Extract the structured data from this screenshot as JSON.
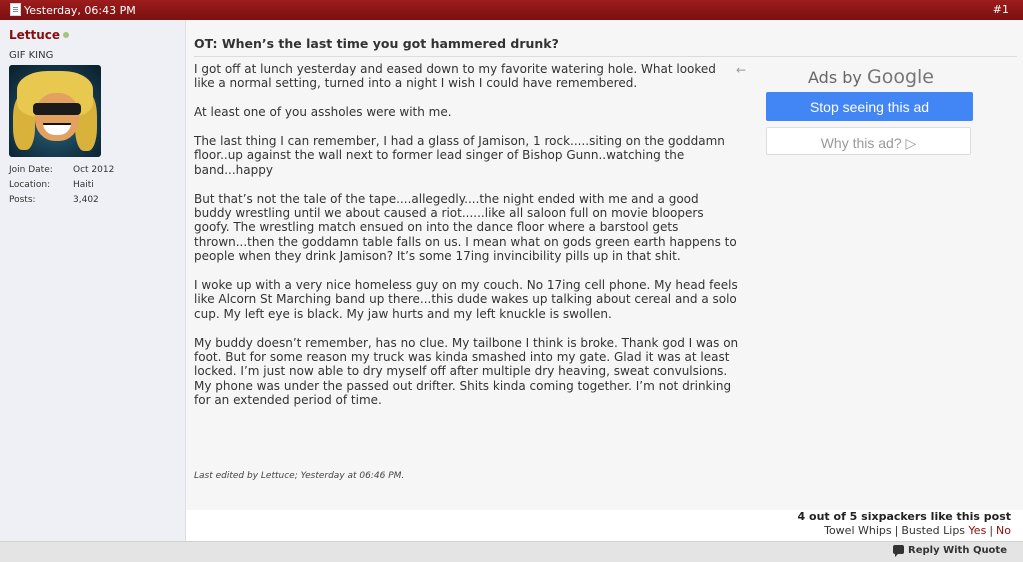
{
  "post": {
    "date": "Yesterday, 06:43 PM",
    "number": "#1"
  },
  "user": {
    "name": "Lettuce",
    "title": "GIF KING",
    "stats": [
      {
        "label": "Join Date:",
        "value": "Oct 2012"
      },
      {
        "label": "Location:",
        "value": "Haiti"
      },
      {
        "label": "Posts:",
        "value": "3,402"
      }
    ]
  },
  "message": {
    "title": "OT: When’s the last time you got hammered drunk?",
    "paragraphs": [
      "I got off at lunch yesterday and eased down to my favorite watering hole. What looked like a normal setting, turned into a night I wish I could have remembered.",
      "At least one of you assholes were with me.",
      "The last thing I can remember, I had a glass of Jamison, 1 rock.....siting on the goddamn floor..up against the wall next to former lead singer of Bishop Gunn..watching the band...happy",
      "But that’s not the tale of the tape....allegedly....the night ended with me and a good buddy wrestling until we about caused a riot......like all saloon full on movie bloopers goofy. The wrestling match ensued on into the dance floor where a barstool gets thrown...then the goddamn table falls on us. I mean what on gods green earth happens to people when they drink Jamison? It’s some 17ing invincibility pills up in that shit.",
      "I woke up with a very nice homeless guy on my couch. No 17ing cell phone. My head feels like Alcorn St Marching band up there...this dude wakes up talking about cereal and a solo cup. My left eye is black. My jaw hurts and my left knuckle is swollen.",
      "My buddy doesn’t remember, has no clue. My tailbone I think is broke. Thank god I was on foot. But for some reason my truck was kinda smashed into my gate. Glad it was at least locked. I’m just now able to dry myself off after multiple dry heaving, sweat convulsions. My phone was under the passed out drifter. Shits kinda coming together. I’m not drinking for an extended period of time."
    ],
    "edited": "Last edited by Lettuce; Yesterday at 06:46 PM."
  },
  "ad": {
    "back_arrow": "←",
    "ads_by": "Ads by",
    "google": "Google",
    "stop_label": "Stop seeing this ad",
    "why_label": "Why this ad? ▷"
  },
  "likes": {
    "summary": "4 out of 5 sixpackers like this post",
    "option1": "Towel Whips",
    "option2": "Busted Lips",
    "yes": "Yes",
    "no": "No"
  },
  "footer": {
    "reply_label": "Reply With Quote"
  },
  "colors": {
    "header_bar": "#8b1515",
    "username": "#8b0c0c",
    "ad_button": "#4285f4"
  },
  "icons": [
    "document-icon",
    "online-status-icon",
    "back-arrow-icon",
    "reply-quote-icon"
  ]
}
